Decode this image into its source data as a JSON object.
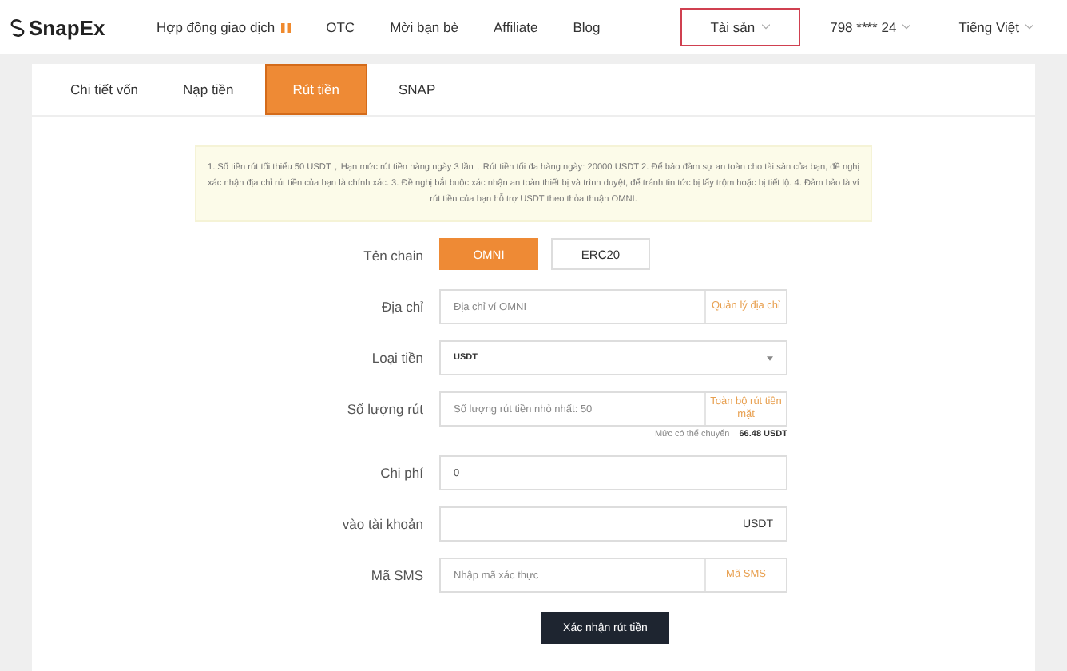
{
  "brand": {
    "name": "SnapEx"
  },
  "nav": [
    {
      "label": "Hợp đồng giao dịch",
      "kind": "badge"
    },
    {
      "label": "OTC",
      "kind": "plain"
    },
    {
      "label": "Mời bạn bè",
      "kind": "plain"
    },
    {
      "label": "Affiliate",
      "kind": "plain"
    },
    {
      "label": "Blog",
      "kind": "plain"
    }
  ],
  "user_menu": [
    {
      "label": "Tài sản",
      "highlighted": true
    },
    {
      "label": "798 **** 24",
      "highlighted": false
    },
    {
      "label": "Tiếng Việt",
      "highlighted": false
    }
  ],
  "tabs": [
    {
      "label": "Chi tiết vốn",
      "selected": false
    },
    {
      "label": "Nạp tiền",
      "selected": false
    },
    {
      "label": "Rút tiền",
      "selected": true
    },
    {
      "label": "SNAP",
      "selected": false
    }
  ],
  "notice": "1. Số tiền rút tối thiểu 50 USDT，Hạn mức rút tiền hàng ngày 3 lần，Rút tiền tối đa hàng ngày: 20000 USDT  2. Để bảo đảm sự an toàn cho tài sản của bạn, đề nghị xác nhận địa chỉ rút tiền của bạn là chính xác.  3. Đề nghị bắt buộc xác nhận an toàn thiết bị và trình duyệt, để tránh tin tức bị lấy trộm hoặc bị tiết lộ.  4. Đảm bảo là ví rút tiền của bạn hỗ trợ USDT theo thỏa thuận OMNI.",
  "form": [
    {
      "kind": "options",
      "label": "Tên chain",
      "options": [
        {
          "label": "OMNI",
          "selected": true
        },
        {
          "label": "ERC20",
          "selected": false
        }
      ]
    },
    {
      "kind": "addon",
      "label": "Địa chỉ",
      "placeholder": "Địa chỉ ví OMNI",
      "addon": "Quản lý địa chỉ"
    },
    {
      "kind": "select",
      "label": "Loại tiền",
      "value": "USDT"
    },
    {
      "kind": "addon",
      "label": "Số lượng rút",
      "placeholder": "Số lượng rút tiền nhỏ nhất: 50",
      "addon": "Toàn bộ rút tiền mặt",
      "note": "Mức có thể chuyển",
      "note_value": "66.48 USDT"
    },
    {
      "kind": "value",
      "label": "Chi phí",
      "value": "0"
    },
    {
      "kind": "suffix",
      "label": "vào tài khoản",
      "suffix": "USDT"
    },
    {
      "kind": "addon",
      "label": "Mã SMS",
      "placeholder": "Nhập mã xác thực",
      "addon": "Mã SMS"
    }
  ],
  "submit": "Xác nhận rút tiền"
}
